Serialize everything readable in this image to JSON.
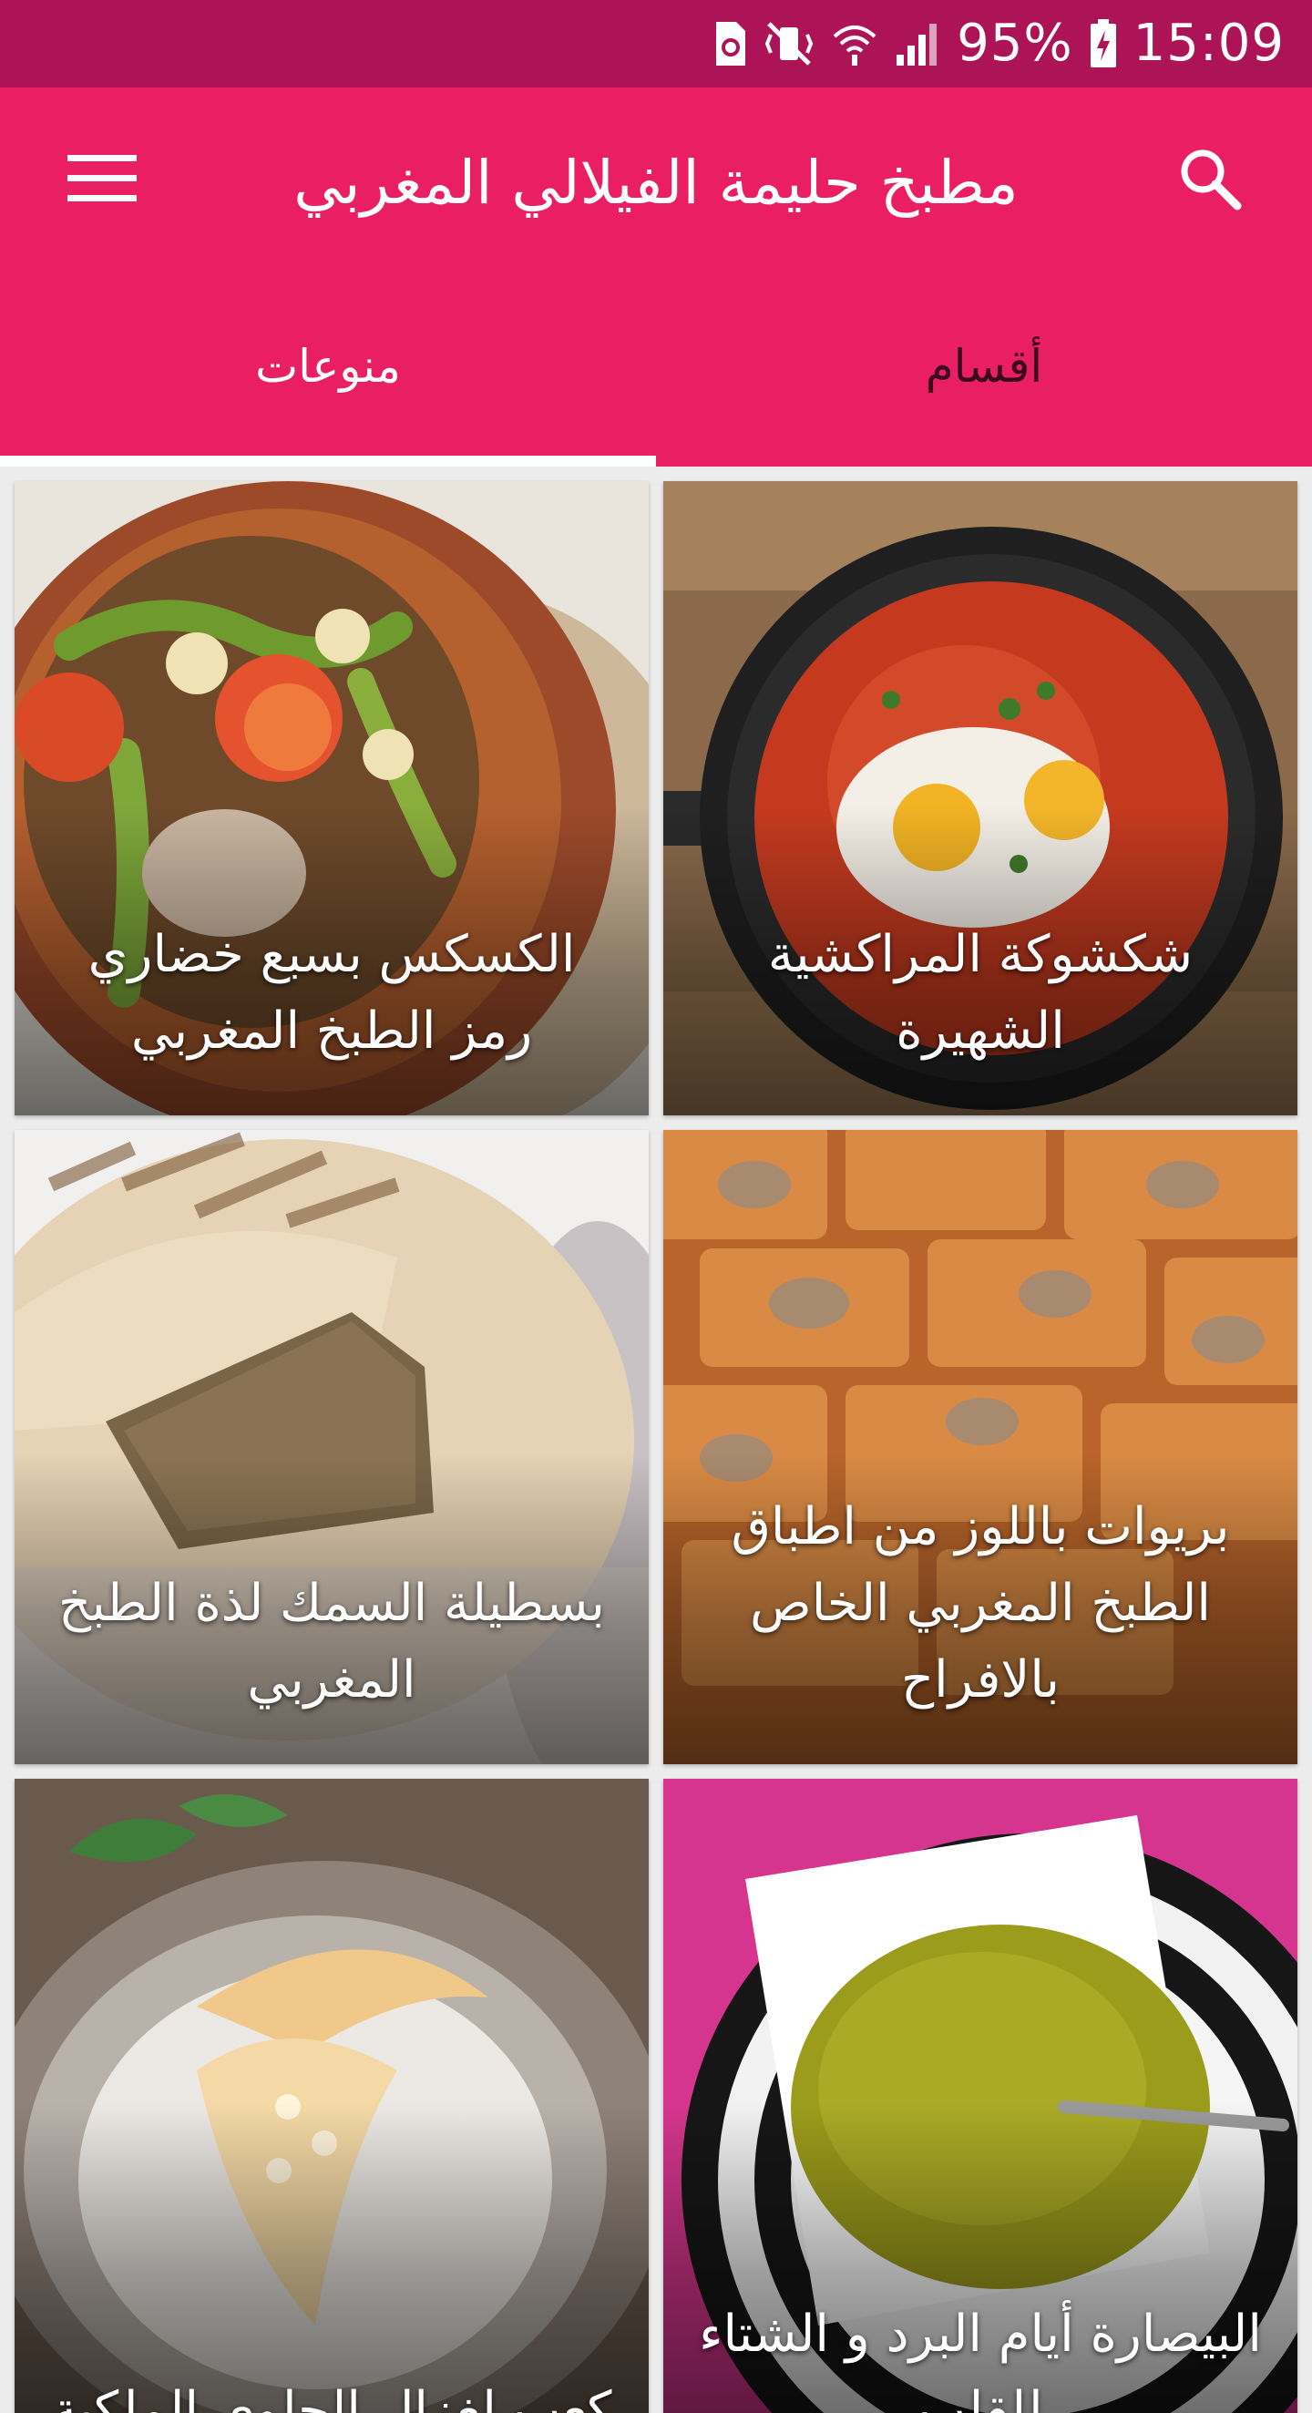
{
  "status_bar": {
    "battery": "95%",
    "time": "15:09"
  },
  "app_bar": {
    "title": "مطبخ حليمة الفيلالي المغربي",
    "menu_icon": "hamburger-menu-icon",
    "search_icon": "search-icon",
    "color": "#e91e63",
    "status_color": "#ad1457"
  },
  "tabs": [
    {
      "label": "منوعات",
      "selected": true
    },
    {
      "label": "أقسام",
      "selected": false
    }
  ],
  "recipes": [
    {
      "title": "الكسكس بسبع خضاري رمز الطبخ المغربي"
    },
    {
      "title": "شكشوكة المراكشية الشهيرة"
    },
    {
      "title": "بسطيلة السمك لذة الطبخ المغربي"
    },
    {
      "title": "بريوات باللوز من اطباق الطبخ المغربي الخاص بالافراح"
    },
    {
      "title": "كعب لغزال الحلوى الملكية"
    },
    {
      "title": "البيصارة أيام البرد و الشتاء للقلب"
    }
  ]
}
